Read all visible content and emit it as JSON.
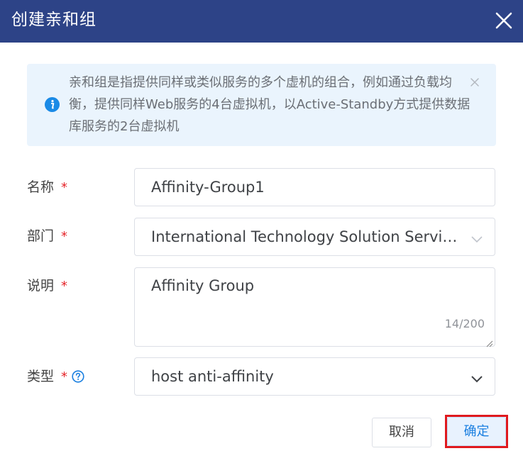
{
  "dialog": {
    "title": "创建亲和组",
    "close_icon": "close-icon"
  },
  "alert": {
    "text": "亲和组是指提供同样或类似服务的多个虚机的组合，例如通过负载均衡，提供同样Web服务的4台虚拟机，以Active-Standby方式提供数据库服务的2台虚拟机",
    "info_icon": "info-icon",
    "close_icon": "close-icon",
    "colors": {
      "background": "#eaf4fd",
      "icon": "#1a8ae6"
    }
  },
  "form": {
    "required_mark": "*",
    "name": {
      "label": "名称",
      "value": "Affinity-Group1"
    },
    "department": {
      "label": "部门",
      "value": "International Technology Solution Service..."
    },
    "description": {
      "label": "说明",
      "value": "Affinity Group",
      "counter": "14/200"
    },
    "type": {
      "label": "类型",
      "value": "host anti-affinity",
      "help_icon": "question-circle-icon"
    }
  },
  "footer": {
    "cancel_label": "取消",
    "confirm_label": "确定"
  },
  "colors": {
    "header": "#2d4387",
    "primary": "#1a7fe0",
    "required": "#e5252a",
    "highlight_outline": "#e0191e"
  }
}
